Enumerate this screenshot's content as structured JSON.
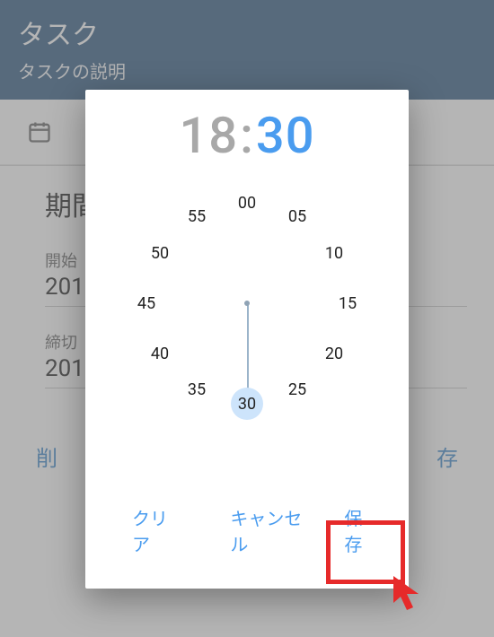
{
  "header": {
    "title": "タスク",
    "subtitle": "タスクの説明"
  },
  "bg": {
    "section_title": "期間",
    "start_label": "開始",
    "start_value": "201",
    "due_label": "締切",
    "due_value": "201",
    "delete_fragment": "削",
    "save_fragment": "存"
  },
  "time_picker": {
    "hour": "18",
    "minute": "30",
    "selected_minute": 30,
    "minutes": [
      "00",
      "05",
      "10",
      "15",
      "20",
      "25",
      "30",
      "35",
      "40",
      "45",
      "50",
      "55"
    ],
    "actions": {
      "clear": "クリア",
      "cancel": "キャンセル",
      "save": "保存"
    }
  }
}
